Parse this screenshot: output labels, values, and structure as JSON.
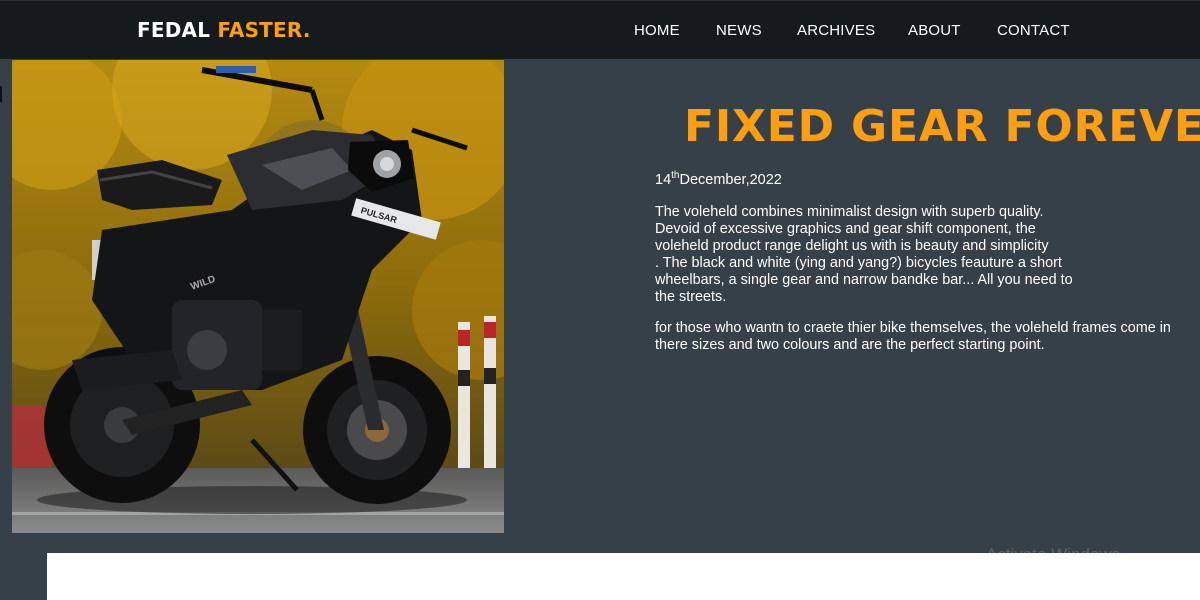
{
  "brand": {
    "part1": "FEDAL",
    "part2": "FASTER."
  },
  "nav": {
    "home": "HOME",
    "news": "NEWS",
    "archives": "ARCHIVES",
    "about": "ABOUT",
    "contact": "CONTACT"
  },
  "hero_image": {
    "subject": "black naked motorcycle on a street in front of autumn yellow trees",
    "plate_text": "PULSAR"
  },
  "article": {
    "title": "FIXED GEAR FOREVER",
    "date_day": "14",
    "date_suffix": "th",
    "date_rest": "December,2022",
    "paragraph1_lines": [
      "The voleheld combines minimalist design with superb quality.",
      "Devoid of excessive graphics and gear shift component, the",
      "voleheld product range delight us with is beauty and simplicity",
      ". The black and white (ying and yang?) bicycles feauture a short",
      "wheelbars, a single gear and narrow bandke bar... All you need to",
      "the streets."
    ],
    "paragraph2_lines": [
      "for those who wantn to craete thier bike themselves, the voleheld frames come in",
      "there sizes and two colours and are the perfect starting point."
    ]
  },
  "watermark": "Activate Windows",
  "colors": {
    "accent": "#ff9f0f",
    "navbar_bg": "#151a1c",
    "page_bg": "#364049",
    "text": "#ffffff"
  }
}
